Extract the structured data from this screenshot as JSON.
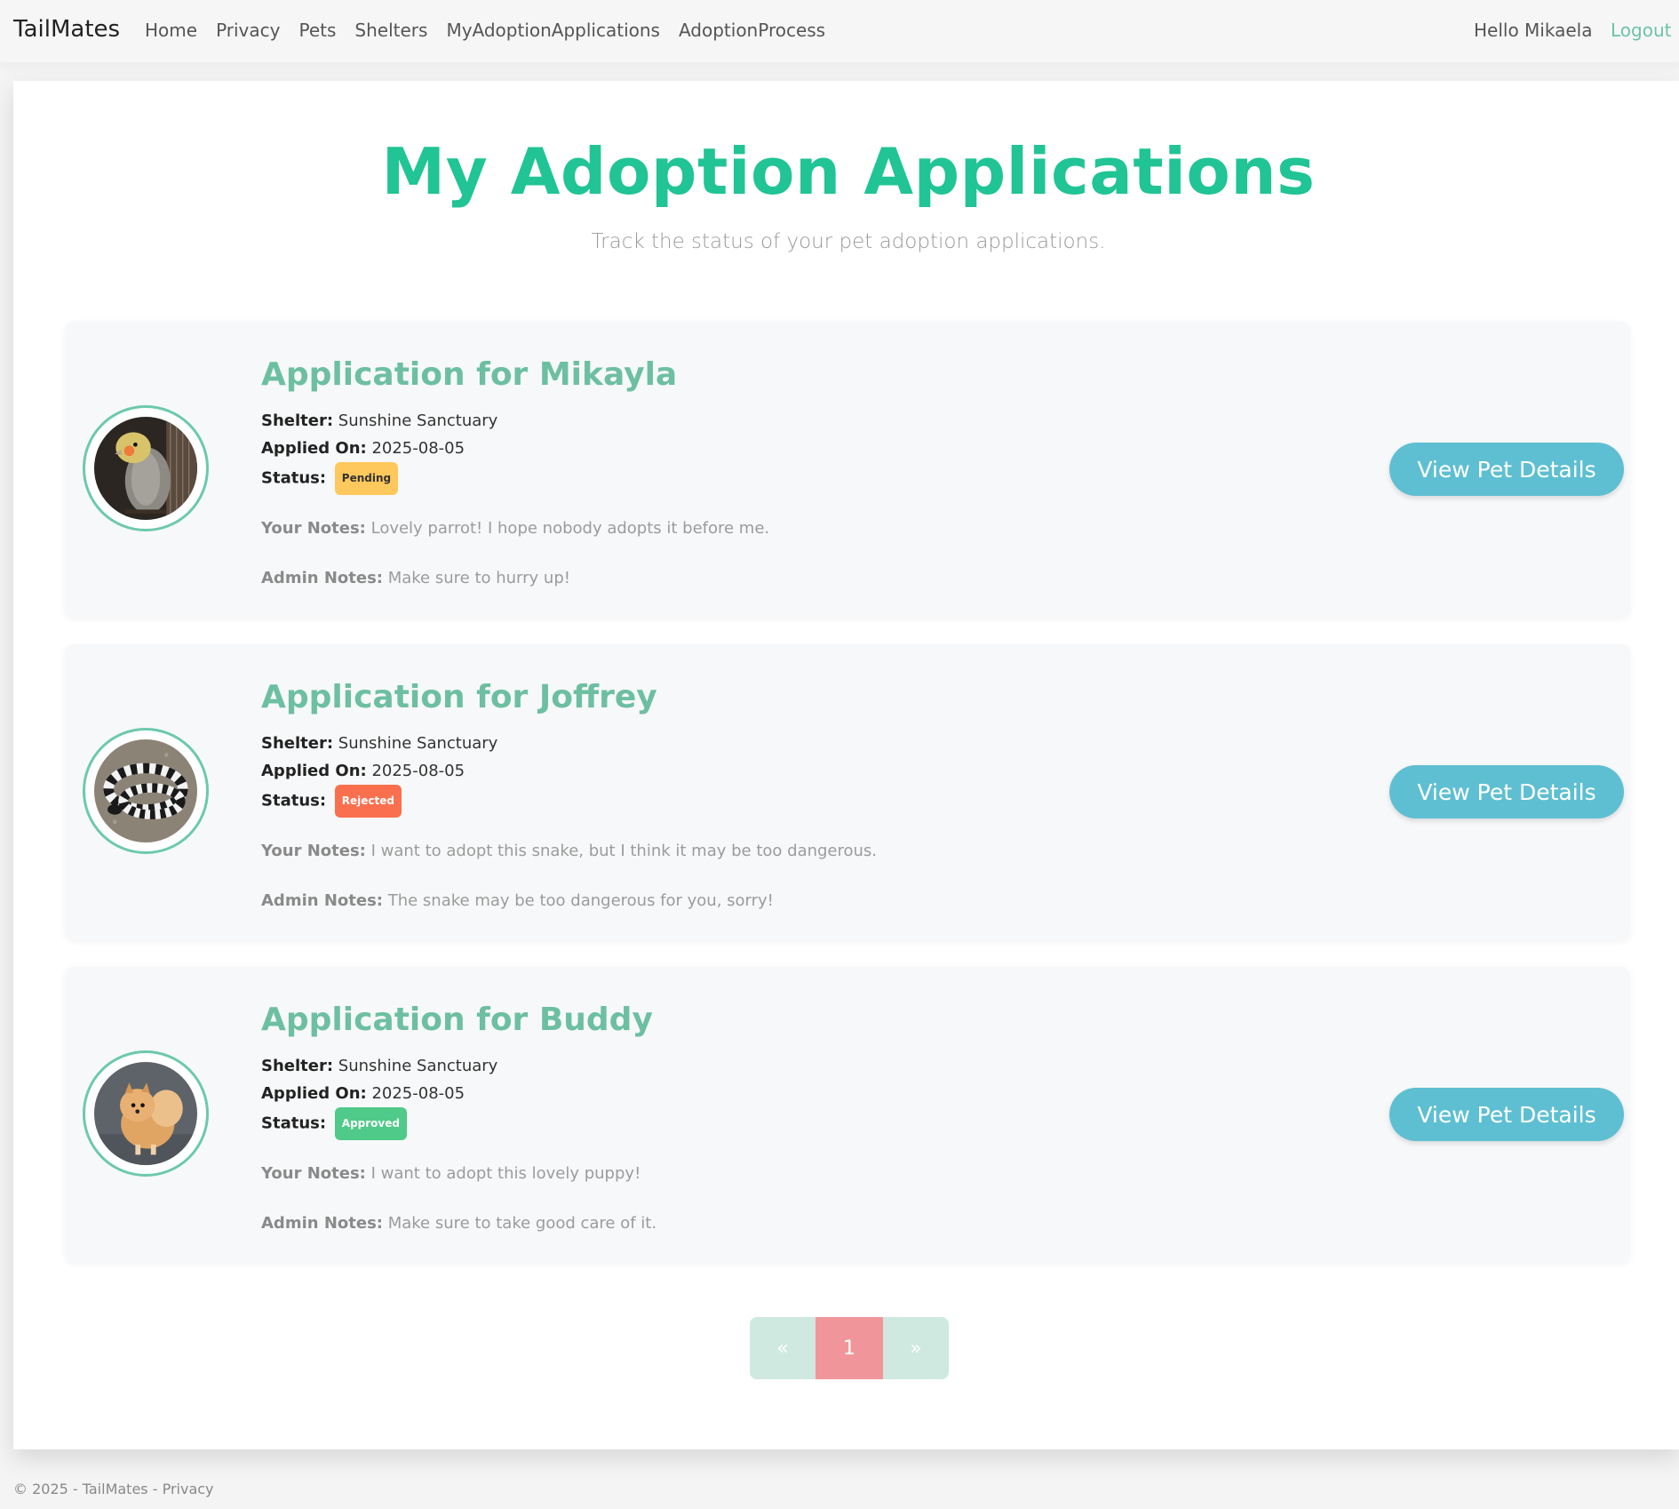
{
  "nav": {
    "brand": "TailMates",
    "links": [
      "Home",
      "Privacy",
      "Pets",
      "Shelters",
      "MyAdoptionApplications",
      "AdoptionProcess"
    ],
    "greeting": "Hello Mikaela",
    "logout": "Logout"
  },
  "page": {
    "title": "My Adoption Applications",
    "subtitle": "Track the status of your pet adoption applications."
  },
  "labels": {
    "shelter": "Shelter:",
    "applied_on": "Applied On:",
    "status": "Status:",
    "your_notes": "Your Notes:",
    "admin_notes": "Admin Notes:",
    "view_button": "View Pet Details"
  },
  "applications": [
    {
      "title": "Application for Mikayla",
      "shelter": "Sunshine Sanctuary",
      "applied_on": "2025-08-05",
      "status": "Pending",
      "your_notes": "Lovely parrot! I hope nobody adopts it before me.",
      "admin_notes": "Make sure to hurry up!",
      "image": "cockatiel-photo"
    },
    {
      "title": "Application for Joffrey",
      "shelter": "Sunshine Sanctuary",
      "applied_on": "2025-08-05",
      "status": "Rejected",
      "your_notes": "I want to adopt this snake, but I think it may be too dangerous.",
      "admin_notes": "The snake may be too dangerous for you, sorry!",
      "image": "snake-photo"
    },
    {
      "title": "Application for Buddy",
      "shelter": "Sunshine Sanctuary",
      "applied_on": "2025-08-05",
      "status": "Approved",
      "your_notes": "I want to adopt this lovely puppy!",
      "admin_notes": "Make sure to take good care of it.",
      "image": "pomeranian-photo"
    }
  ],
  "pagination": {
    "prev": "«",
    "current": "1",
    "next": "»"
  },
  "footer": {
    "text": "© 2025 - TailMates - ",
    "link": "Privacy"
  },
  "colors": {
    "accent": "#21c494",
    "card_title": "#6dbfa2",
    "button": "#5fbfd2",
    "pending": "#ffc85c",
    "rejected": "#fa6f4d",
    "approved": "#4fca88",
    "page_active": "#f0969a"
  }
}
